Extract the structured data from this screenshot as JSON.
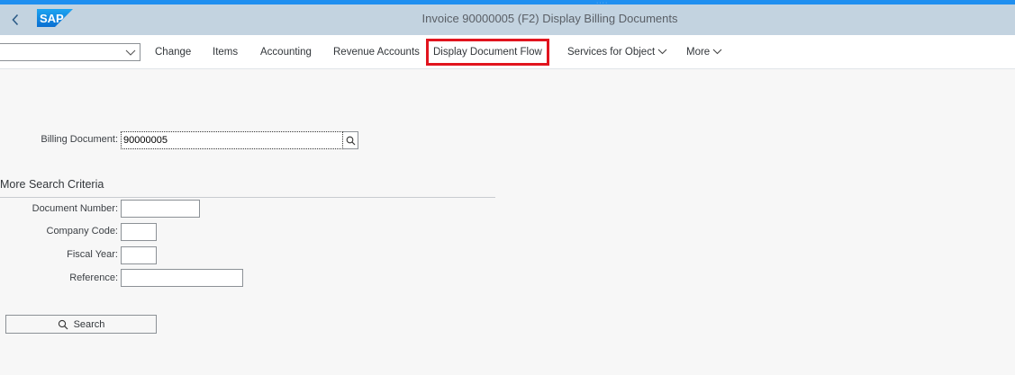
{
  "shell": {
    "title": "Invoice 90000005   (F2) Display Billing Documents",
    "logo_text": "SAP",
    "brand_color": "#1f8ff0"
  },
  "toolbar": {
    "select_value": "",
    "change": "Change",
    "items": "Items",
    "accounting": "Accounting",
    "revenue_accounts": "Revenue Accounts",
    "display_document_flow": "Display Document Flow",
    "services_for_object": "Services for Object",
    "more": "More"
  },
  "form": {
    "billing_document_label": "Billing Document:",
    "billing_document_value": "90000005",
    "more_criteria_title": "More Search Criteria",
    "document_number_label": "Document Number:",
    "document_number_value": "",
    "company_code_label": "Company Code:",
    "company_code_value": "",
    "fiscal_year_label": "Fiscal Year:",
    "fiscal_year_value": "",
    "reference_label": "Reference:",
    "reference_value": "",
    "search_label": "Search"
  }
}
